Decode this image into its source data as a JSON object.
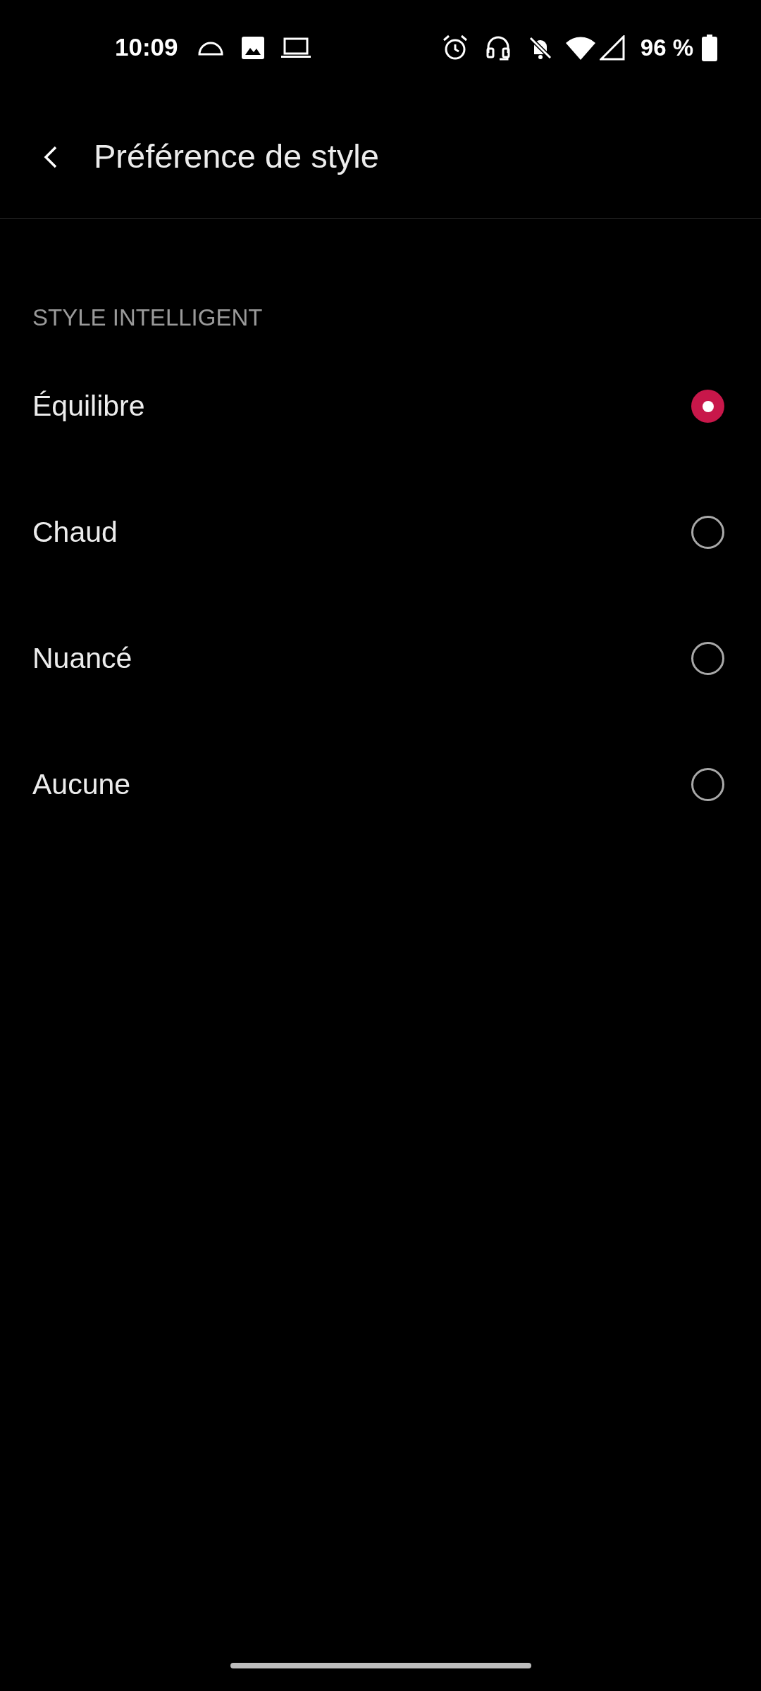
{
  "status_bar": {
    "time": "10:09",
    "battery": "96 %"
  },
  "header": {
    "title": "Préférence de style"
  },
  "section": {
    "title": "STYLE INTELLIGENT"
  },
  "options": [
    {
      "label": "Équilibre",
      "selected": true
    },
    {
      "label": "Chaud",
      "selected": false
    },
    {
      "label": "Nuancé",
      "selected": false
    },
    {
      "label": "Aucune",
      "selected": false
    }
  ]
}
